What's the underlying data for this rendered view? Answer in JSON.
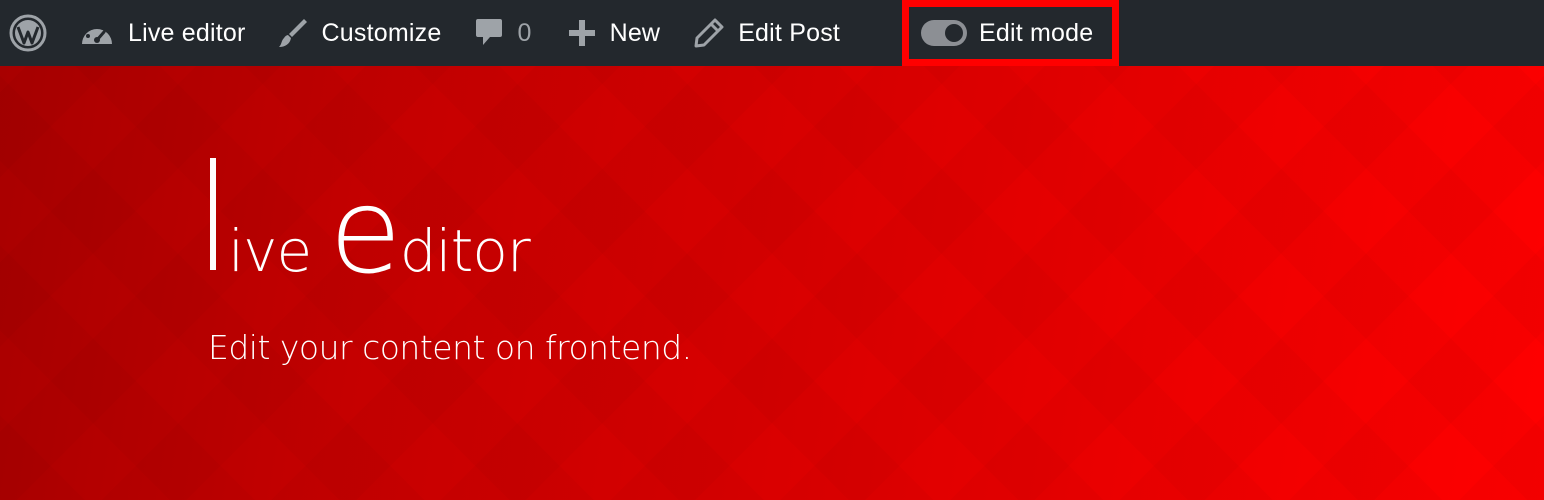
{
  "adminbar": {
    "wp_logo_icon": "wordpress-icon",
    "live_editor": {
      "icon": "dashboard-gauge-icon",
      "label": "Live editor"
    },
    "customize": {
      "icon": "paintbrush-icon",
      "label": "Customize"
    },
    "comments": {
      "icon": "comment-bubble-icon",
      "count": "0"
    },
    "new": {
      "icon": "plus-icon",
      "label": "New"
    },
    "edit_post": {
      "icon": "pencil-icon",
      "label": "Edit Post"
    },
    "edit_mode": {
      "icon": "toggle-switch-icon",
      "label": "Edit mode",
      "toggle_on": true,
      "highlight_color": "#ff0000"
    },
    "background_color": "#23282d"
  },
  "hero": {
    "title_first_letter": "l",
    "title_rest_1": "ive",
    "title_big_e": "e",
    "title_rest_2": "ditor",
    "subtitle": "Edit your content on frontend.",
    "gradient_start": "#a80000",
    "gradient_end": "#ff0000"
  }
}
